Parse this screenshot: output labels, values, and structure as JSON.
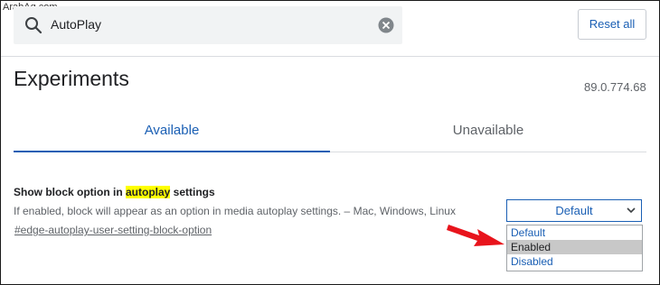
{
  "watermark": "ArabAq.com",
  "search": {
    "value": "AutoPlay",
    "icon": "search-icon",
    "clear_icon": "clear-icon"
  },
  "toolbar": {
    "reset_label": "Reset all"
  },
  "page": {
    "title": "Experiments",
    "version": "89.0.774.68"
  },
  "tabs": [
    {
      "label": "Available",
      "active": true
    },
    {
      "label": "Unavailable",
      "active": false
    }
  ],
  "experiment": {
    "title_before": "Show block option in ",
    "title_highlight": "autoplay",
    "title_after": " settings",
    "description": "If enabled, block will appear as an option in media autoplay settings. – Mac, Windows, Linux",
    "link": "#edge-autoplay-user-setting-block-option",
    "select_value": "Default",
    "options": [
      "Default",
      "Enabled",
      "Disabled"
    ],
    "highlighted_option": "Enabled"
  },
  "colors": {
    "accent": "#1a5fb4",
    "highlight": "#ffff00",
    "annotation_arrow": "#e8141c"
  }
}
